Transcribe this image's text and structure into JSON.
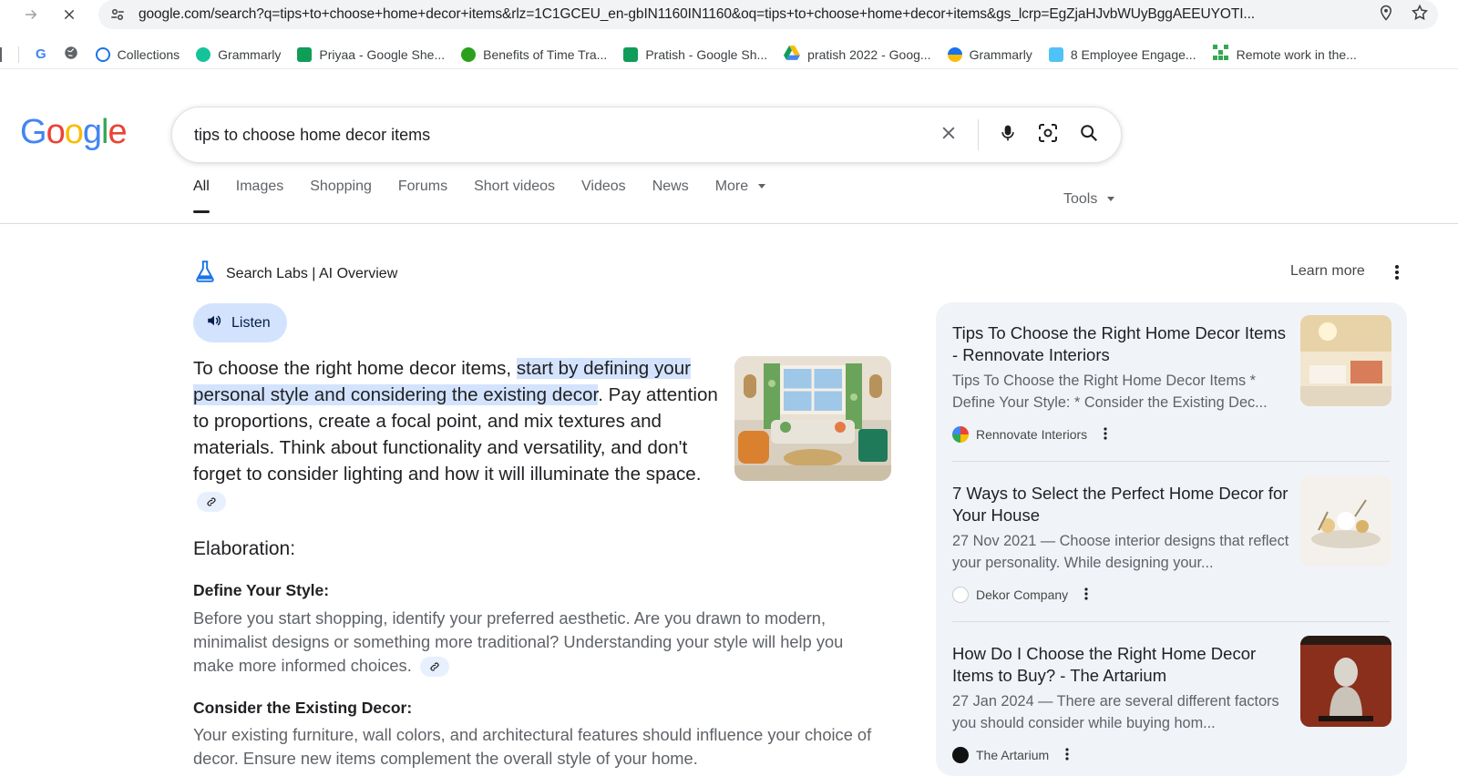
{
  "browser": {
    "url": "google.com/search?q=tips+to+choose+home+decor+items&rlz=1C1GCEU_en-gbIN1160IN1160&oq=tips+to+choose+home+decor+items&gs_lcrp=EgZjaHJvbWUyBggAEEUYOTI...",
    "bookmarks": [
      {
        "label": "",
        "icon": "google-icon"
      },
      {
        "label": "",
        "icon": "globe-icon"
      },
      {
        "label": "Collections",
        "icon": "collections-icon",
        "color": "#1a73e8"
      },
      {
        "label": "Grammarly",
        "icon": "grammarly-icon",
        "color": "#15c39a"
      },
      {
        "label": "Priyaa - Google She...",
        "icon": "sheets-icon",
        "color": "#0f9d58"
      },
      {
        "label": "Benefits of Time Tra...",
        "icon": "quickbooks-icon",
        "color": "#2ca01c"
      },
      {
        "label": "Pratish - Google Sh...",
        "icon": "sheets-icon",
        "color": "#0f9d58"
      },
      {
        "label": "pratish 2022 - Goog...",
        "icon": "drive-icon",
        "color": "#fbbc04"
      },
      {
        "label": "Grammarly",
        "icon": "grammarly-icon",
        "color": "#1a73e8"
      },
      {
        "label": "8 Employee Engage...",
        "icon": "doc-icon",
        "color": "#4fc3f7"
      },
      {
        "label": "Remote work in the...",
        "icon": "grid-icon",
        "color": "#34a853"
      }
    ]
  },
  "google": {
    "logo": "Google",
    "query": "tips to choose home decor items",
    "tabs": [
      "All",
      "Images",
      "Shopping",
      "Forums",
      "Short videos",
      "Videos",
      "News",
      "More"
    ],
    "tools_label": "Tools"
  },
  "ai_overview": {
    "header": "Search Labs | AI Overview",
    "learn_more": "Learn more",
    "listen": "Listen",
    "summary_pre": "To choose the right home decor items, ",
    "summary_hl": "start by defining your personal style and considering the existing decor",
    "summary_post": ". Pay attention to proportions, create a focal point, and mix textures and materials. Think about functionality and versatility, and don't forget to consider lighting and how it will illuminate the space.",
    "elaboration": "Elaboration:",
    "sections": [
      {
        "title": "Define Your Style:",
        "body": "Before you start shopping, identify your preferred aesthetic. Are you drawn to modern, minimalist designs or something more traditional? Understanding your style will help you make more informed choices."
      },
      {
        "title": "Consider the Existing Decor:",
        "body": "Your existing furniture, wall colors, and architectural features should influence your choice of decor. Ensure new items complement the overall style of your home."
      }
    ]
  },
  "sources": [
    {
      "title": "Tips To Choose the Right Home Decor Items - Rennovate Interiors",
      "snippet": "Tips To Choose the Right Home Decor Items * Define Your Style: * Consider the Existing Dec...",
      "site": "Rennovate Interiors"
    },
    {
      "title": "7 Ways to Select the Perfect Home Decor for Your House",
      "snippet": "27 Nov 2021 — Choose interior designs that reflect your personality. While designing your...",
      "site": "Dekor Company"
    },
    {
      "title": "How Do I Choose the Right Home Decor Items to Buy? - The Artarium",
      "snippet": "27 Jan 2024 — There are several different factors you should consider while buying hom...",
      "site": "The Artarium"
    }
  ]
}
